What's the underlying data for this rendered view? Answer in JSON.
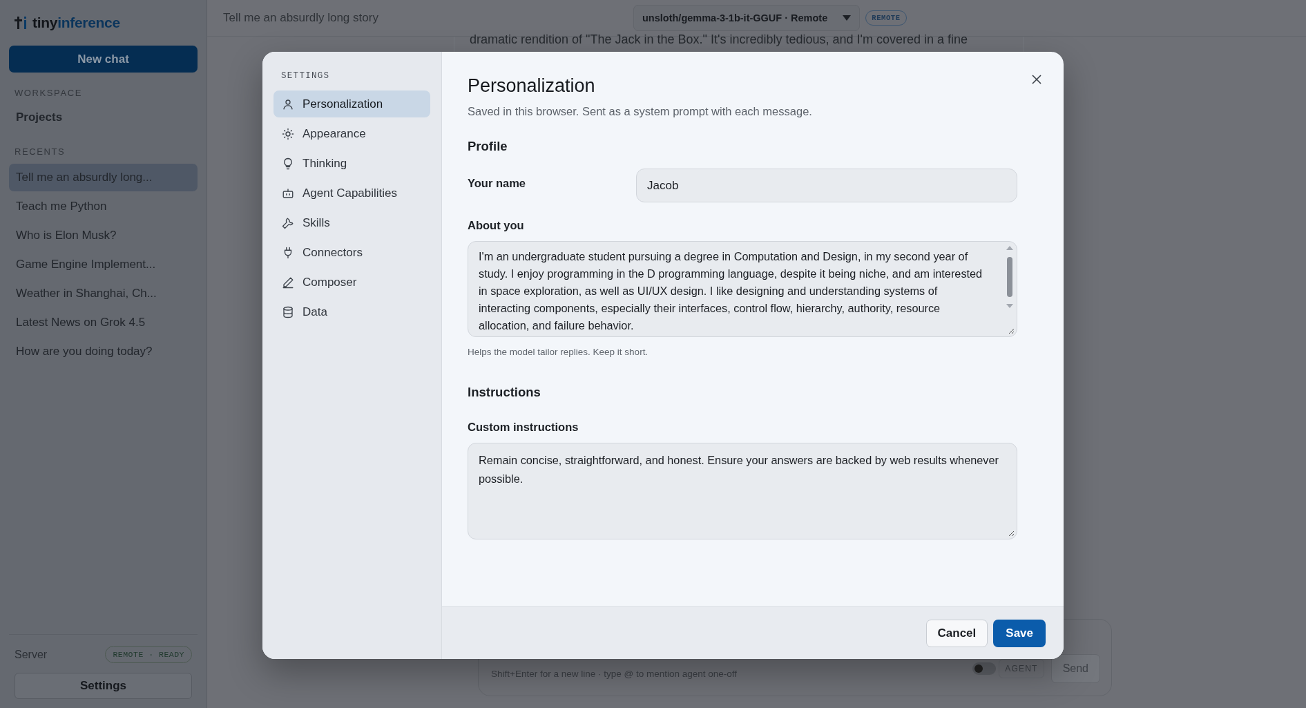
{
  "sidebar": {
    "logo": [
      {
        "text": "tiny",
        "accent": false
      },
      {
        "text": "inference",
        "accent": true
      }
    ],
    "new_chat": "New chat",
    "workspace_heading": "WORKSPACE",
    "workspace_items": [
      {
        "label": "Projects"
      }
    ],
    "recents_heading": "RECENTS",
    "recents": [
      {
        "label": "Tell me an absurdly long...",
        "selected": true
      },
      {
        "label": "Teach me Python",
        "selected": false
      },
      {
        "label": "Who is Elon Musk?",
        "selected": false
      },
      {
        "label": "Game Engine Implement...",
        "selected": false
      },
      {
        "label": "Weather in Shanghai, Ch...",
        "selected": false
      },
      {
        "label": "Latest News on Grok 4.5",
        "selected": false
      },
      {
        "label": "How are you doing today?",
        "selected": false
      }
    ],
    "server": {
      "label": "Server",
      "status": "REMOTE · READY"
    },
    "settings_button": "Settings"
  },
  "header": {
    "chat_title": "Tell me an absurdly long story",
    "model": "unsloth/gemma-3-1b-it-GGUF · Remote",
    "mode_badge": "REMOTE"
  },
  "conversation": {
    "visible_line": "dramatic rendition of \"The Jack in the Box.\" It's incredibly tedious, and I'm covered in a fine"
  },
  "composer": {
    "hint": "Shift+Enter for a new line · type @ to mention agent one-off",
    "agent": {
      "label": "AGENT",
      "on": false
    },
    "send": {
      "label": "Send",
      "disabled": true
    }
  },
  "settings_dialog": {
    "nav_heading": "SETTINGS",
    "nav": [
      {
        "label": "Personalization",
        "selected": true
      },
      {
        "label": "Appearance",
        "selected": false
      },
      {
        "label": "Thinking",
        "selected": false
      },
      {
        "label": "Agent Capabilities",
        "selected": false
      },
      {
        "label": "Skills",
        "selected": false
      },
      {
        "label": "Connectors",
        "selected": false
      },
      {
        "label": "Composer",
        "selected": false
      },
      {
        "label": "Data",
        "selected": false
      }
    ],
    "title": "Personalization",
    "subtitle": "Saved in this browser. Sent as a system prompt with each message.",
    "profile_heading": "Profile",
    "name_label": "Your name",
    "name_value": "Jacob",
    "about_label": "About you",
    "about_value": "I'm an undergraduate student pursuing a degree in Computation and Design, in my second year of study. I enjoy programming in the D programming language, despite it being niche, and am interested in space exploration, as well as UI/UX design. I like designing and understanding systems of interacting components, especially their interfaces, control flow, hierarchy, authority, resource allocation, and failure behavior.",
    "about_help": "Helps the model tailor replies. Keep it short.",
    "instructions_heading": "Instructions",
    "custom_label": "Custom instructions",
    "custom_value": "Remain concise, straightforward, and honest. Ensure your answers are backed by web results whenever possible.",
    "cancel": "Cancel",
    "save": "Save"
  }
}
